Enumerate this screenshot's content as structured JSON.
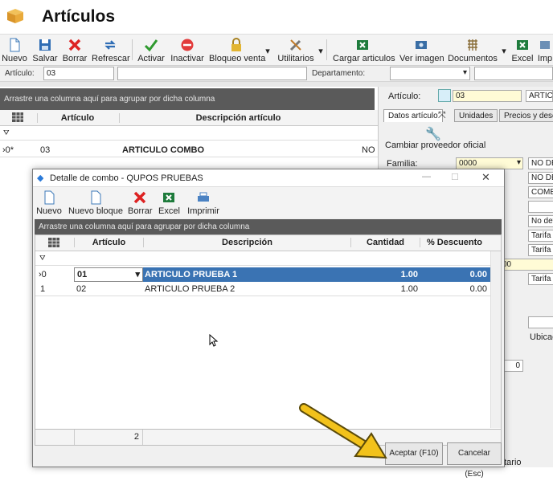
{
  "app": {
    "title": "Artículos",
    "icon": "box-icon"
  },
  "toolbar": {
    "nuevo": "Nuevo",
    "salvar": "Salvar",
    "borrar": "Borrar",
    "refrescar": "Refrescar",
    "activar": "Activar",
    "inactivar": "Inactivar",
    "bloqueo": "Bloqueo venta",
    "utilitarios": "Utilitarios",
    "cargar": "Cargar articulos",
    "ver_imagen": "Ver imagen",
    "documentos": "Documentos",
    "excel": "Excel",
    "importar": "Imp"
  },
  "filter": {
    "articulo_label": "Artículo:",
    "articulo_value": "03",
    "descripcion_value": "",
    "departamento_label": "Departamento:"
  },
  "main_grid": {
    "group_hint": "Arrastre una columna aquí para agrupar por dicha columna",
    "columns": [
      "Artículo",
      "Descripción artículo"
    ],
    "rows": [
      {
        "indicator": "0*",
        "articulo": "03",
        "descripcion": "ARTICULO COMBO",
        "extra": "NO I"
      }
    ]
  },
  "right_panel": {
    "articulo_label": "Artículo:",
    "articulo_value": "03",
    "articulo_desc": "ARTIC",
    "tabs": [
      "Datos artículo",
      "Unidades",
      "Precios y descu"
    ],
    "cambiar_proveedor": "Cambiar proveedor oficial",
    "familia_label": "Familia:",
    "familia_value": "0000",
    "right_values": [
      "NO DE",
      "NO DE",
      "COMER",
      "",
      "No def",
      "Tarifa g",
      "Tarifa g"
    ],
    "field_00": "00",
    "tarifa_g": "Tarifa g",
    "ubicacion": "Ubicac",
    "zero": "0",
    "status": "atario"
  },
  "dialog": {
    "title": "Detalle de combo - QUPOS PRUEBAS",
    "toolbar": {
      "nuevo": "Nuevo",
      "nuevo_bloque": "Nuevo bloque",
      "borrar": "Borrar",
      "excel": "Excel",
      "imprimir": "Imprimir"
    },
    "group_hint": "Arrastre una columna aquí para agrupar por dicha columna",
    "columns": [
      "Artículo",
      "Descripción",
      "Cantidad",
      "% Descuento"
    ],
    "rows": [
      {
        "indicator": "0",
        "articulo": "01",
        "descripcion": "ARTICULO PRUEBA 1",
        "cantidad": "1.00",
        "descuento": "0.00"
      },
      {
        "indicator": "1",
        "articulo": "02",
        "descripcion": "ARTICULO PRUEBA 2",
        "cantidad": "1.00",
        "descuento": "0.00"
      }
    ],
    "footer_count": "2",
    "aceptar": "Aceptar (F10)",
    "cancelar": "Cancelar (Esc)"
  },
  "colors": {
    "accent": "#3c7ab8",
    "selection": "#3a73b3",
    "arrow": "#f2c21b",
    "group_bar": "#5a5a5a"
  }
}
